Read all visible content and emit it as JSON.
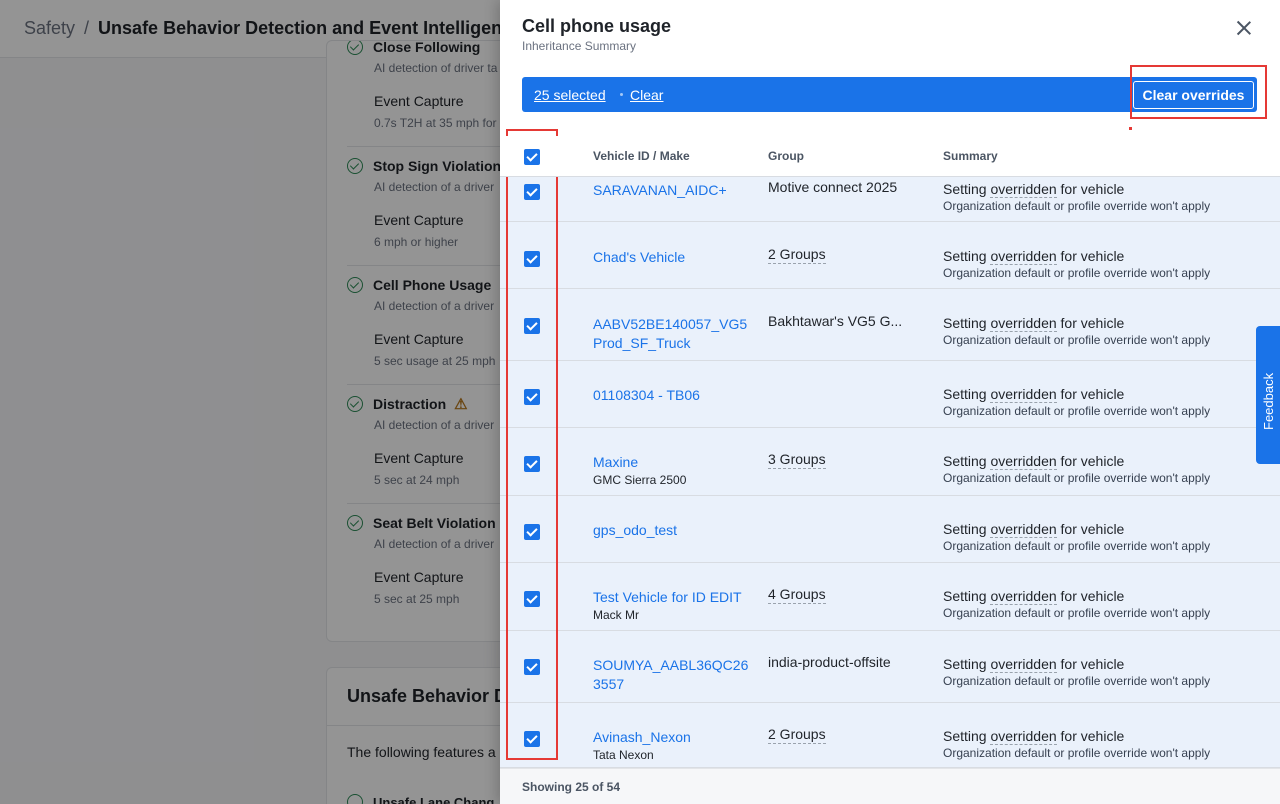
{
  "background": {
    "breadcrumb": "Safety",
    "separator": "/",
    "page_title": "Unsafe Behavior Detection and Event Intelligence",
    "items": [
      {
        "title": "Close Following",
        "sub": "AI detection of driver ta",
        "event": "Event Capture",
        "event_sub": "0.7s T2H at 35 mph for"
      },
      {
        "title": "Stop Sign Violation",
        "sub": "AI detection of a driver",
        "event": "Event Capture",
        "event_sub": "6 mph or higher"
      },
      {
        "title": "Cell Phone Usage",
        "sub": "AI detection of a driver",
        "event": "Event Capture",
        "event_sub": "5 sec usage at 25 mph"
      },
      {
        "title": "Distraction",
        "sub": "AI detection of a driver",
        "event": "Event Capture",
        "event_sub": "5 sec at 24 mph"
      },
      {
        "title": "Seat Belt Violation",
        "sub": "AI detection of a driver",
        "event": "Event Capture",
        "event_sub": "5 sec at 25 mph"
      }
    ],
    "section2_title": "Unsafe Behavior D",
    "section2_text": "The following features a",
    "section2_item": "Unsafe Lane Chang"
  },
  "drawer": {
    "title": "Cell phone usage",
    "subtitle": "Inheritance Summary",
    "selected_label": "25 selected",
    "clear_label": "Clear",
    "clear_overrides_label": "Clear overrides",
    "columns": {
      "vehicle": "Vehicle ID / Make",
      "group": "Group",
      "summary": "Summary"
    },
    "rows": [
      {
        "vehicle": "SARAVANAN_AIDC+",
        "make": "",
        "group": "Motive connect 2025",
        "group_dotted": false,
        "summary": "Setting overridden for vehicle",
        "summary_sub": "Organization default or profile override won't apply"
      },
      {
        "vehicle": "Chad's Vehicle",
        "make": "",
        "group": "2 Groups",
        "group_dotted": true,
        "summary": "Setting overridden for vehicle",
        "summary_sub": "Organization default or profile override won't apply"
      },
      {
        "vehicle": "AABV52BE140057_VG5Prod_SF_Truck",
        "make": "",
        "group": "Bakhtawar's VG5 G...",
        "group_dotted": false,
        "summary": "Setting overridden for vehicle",
        "summary_sub": "Organization default or profile override won't apply"
      },
      {
        "vehicle": "01108304 - TB06",
        "make": "",
        "group": "",
        "group_dotted": false,
        "summary": "Setting overridden for vehicle",
        "summary_sub": "Organization default or profile override won't apply"
      },
      {
        "vehicle": "Maxine",
        "make": "GMC Sierra 2500",
        "group": "3 Groups",
        "group_dotted": true,
        "summary": "Setting overridden for vehicle",
        "summary_sub": "Organization default or profile override won't apply"
      },
      {
        "vehicle": "gps_odo_test",
        "make": "",
        "group": "",
        "group_dotted": false,
        "summary": "Setting overridden for vehicle",
        "summary_sub": "Organization default or profile override won't apply"
      },
      {
        "vehicle": "Test Vehicle for ID EDIT",
        "make": "Mack Mr",
        "group": "4 Groups",
        "group_dotted": true,
        "summary": "Setting overridden for vehicle",
        "summary_sub": "Organization default or profile override won't apply"
      },
      {
        "vehicle": "SOUMYA_AABL36QC263557",
        "make": "",
        "group": "india-product-offsite",
        "group_dotted": false,
        "summary": "Setting overridden for vehicle",
        "summary_sub": "Organization default or profile override won't apply"
      },
      {
        "vehicle": "Avinash_Nexon",
        "make": "Tata Nexon",
        "group": "2 Groups",
        "group_dotted": true,
        "summary": "Setting overridden for vehicle",
        "summary_sub": "Organization default or profile override won't apply"
      }
    ],
    "footer": "Showing 25 of 54",
    "dashed_word": "overridden"
  },
  "feedback_label": "Feedback",
  "colors": {
    "accent": "#1a73e8",
    "highlight": "#e53935",
    "row_selected": "#eaf1fb"
  }
}
